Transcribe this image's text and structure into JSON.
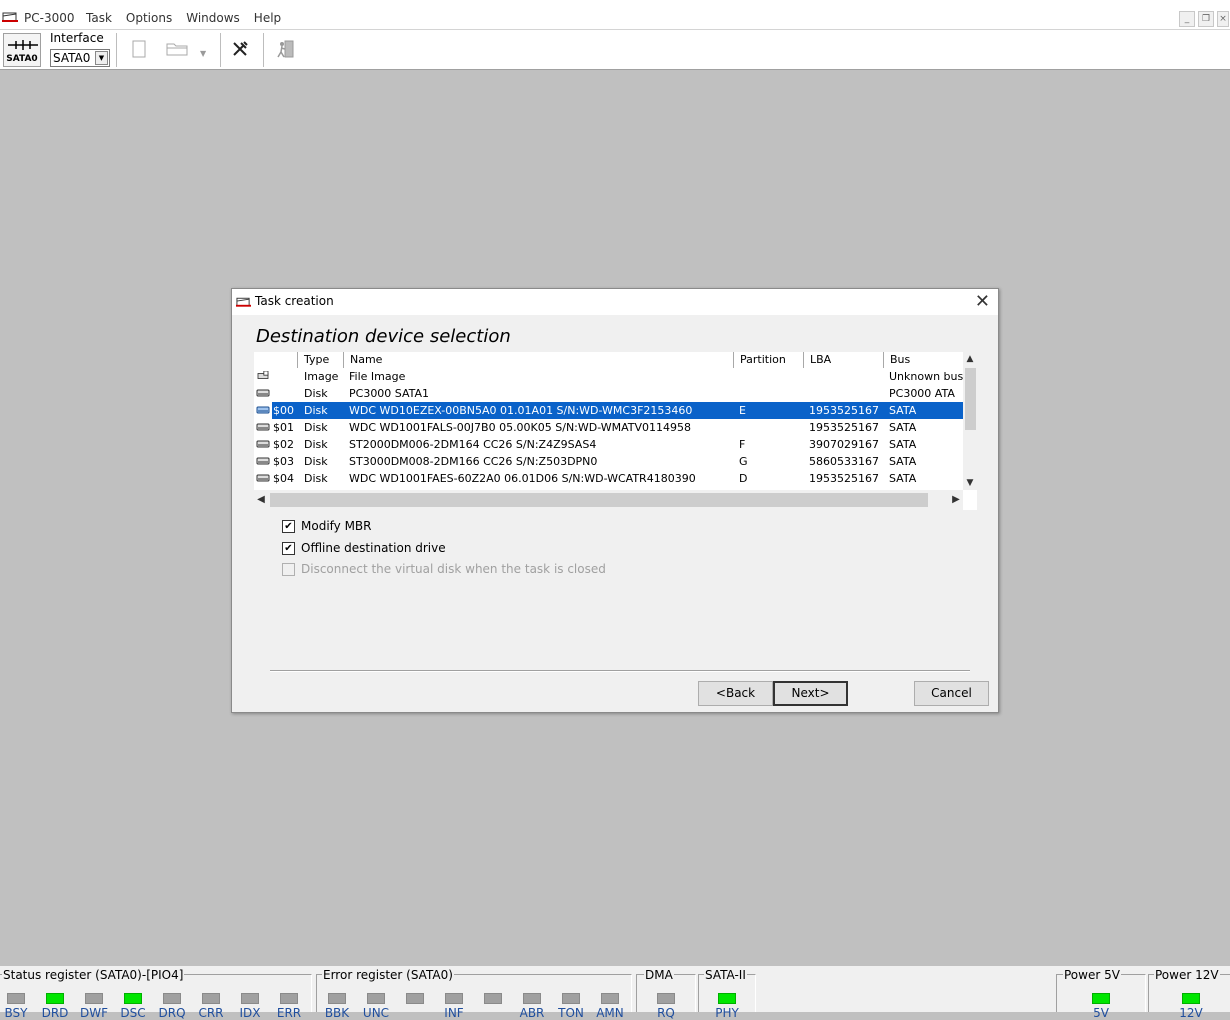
{
  "app": {
    "title": "PC-3000"
  },
  "menu": [
    "Task",
    "Options",
    "Windows",
    "Help"
  ],
  "toolbar": {
    "sata_label": "SATA0",
    "interface_label": "Interface",
    "interface_value": "SATA0"
  },
  "dialog": {
    "title": "Task creation",
    "heading": "Destination device selection",
    "columns": [
      "Type",
      "Name",
      "Partition",
      "LBA",
      "Bus"
    ],
    "rows": [
      {
        "id": "",
        "type": "Image",
        "name": "File Image",
        "partition": "",
        "lba": "",
        "bus": "Unknown bus",
        "icon": "file-image-icon"
      },
      {
        "id": "",
        "type": "Disk",
        "name": "PC3000 SATA1",
        "partition": "",
        "lba": "",
        "bus": "PC3000 ATA",
        "icon": "disk-icon"
      },
      {
        "id": "$00",
        "type": "Disk",
        "name": "WDC WD10EZEX-00BN5A0 01.01A01 S/N:WD-WMC3F2153460",
        "partition": "E",
        "lba": "1953525167",
        "bus": "SATA",
        "icon": "disk-icon",
        "selected": true
      },
      {
        "id": "$01",
        "type": "Disk",
        "name": "WDC WD1001FALS-00J7B0 05.00K05 S/N:WD-WMATV0114958",
        "partition": "",
        "lba": "1953525167",
        "bus": "SATA",
        "icon": "disk-icon"
      },
      {
        "id": "$02",
        "type": "Disk",
        "name": "ST2000DM006-2DM164 CC26 S/N:Z4Z9SAS4",
        "partition": "F",
        "lba": "3907029167",
        "bus": "SATA",
        "icon": "disk-icon"
      },
      {
        "id": "$03",
        "type": "Disk",
        "name": "ST3000DM008-2DM166 CC26 S/N:Z503DPN0",
        "partition": "G",
        "lba": "5860533167",
        "bus": "SATA",
        "icon": "disk-icon"
      },
      {
        "id": "$04",
        "type": "Disk",
        "name": "WDC WD1001FAES-60Z2A0 06.01D06 S/N:WD-WCATR4180390",
        "partition": "D",
        "lba": "1953525167",
        "bus": "SATA",
        "icon": "disk-icon"
      }
    ],
    "options": {
      "modify_mbr": {
        "label": "Modify MBR",
        "checked": true
      },
      "offline": {
        "label": "Offline destination drive",
        "checked": true
      },
      "disconnect": {
        "label": "Disconnect the virtual disk when the task is closed",
        "checked": false,
        "disabled": true
      }
    },
    "buttons": {
      "back": "<Back",
      "next": "Next>",
      "cancel": "Cancel"
    }
  },
  "status": {
    "status_register": {
      "title": "Status register (SATA0)-[PIO4]",
      "leds": [
        {
          "label": "BSY",
          "on": false
        },
        {
          "label": "DRD",
          "on": true
        },
        {
          "label": "DWF",
          "on": false
        },
        {
          "label": "DSC",
          "on": true
        },
        {
          "label": "DRQ",
          "on": false
        },
        {
          "label": "CRR",
          "on": false
        },
        {
          "label": "IDX",
          "on": false
        },
        {
          "label": "ERR",
          "on": false
        }
      ]
    },
    "error_register": {
      "title": "Error register (SATA0)",
      "leds": [
        {
          "label": "BBK",
          "on": false
        },
        {
          "label": "UNC",
          "on": false
        },
        {
          "label": "",
          "on": false
        },
        {
          "label": "INF",
          "on": false
        },
        {
          "label": "",
          "on": false
        },
        {
          "label": "ABR",
          "on": false
        },
        {
          "label": "TON",
          "on": false
        },
        {
          "label": "AMN",
          "on": false
        }
      ]
    },
    "dma": {
      "title": "DMA",
      "leds": [
        {
          "label": "RQ",
          "on": false
        }
      ]
    },
    "sata2": {
      "title": "SATA-II",
      "leds": [
        {
          "label": "PHY",
          "on": true
        }
      ]
    },
    "power5": {
      "title": "Power 5V",
      "leds": [
        {
          "label": "5V",
          "on": true
        }
      ]
    },
    "power12": {
      "title": "Power 12V",
      "leds": [
        {
          "label": "12V",
          "on": true
        }
      ]
    }
  },
  "colors": {
    "selection": "#0a62c9",
    "led_on": "#00e600",
    "led_off": "#a0a0a0"
  }
}
